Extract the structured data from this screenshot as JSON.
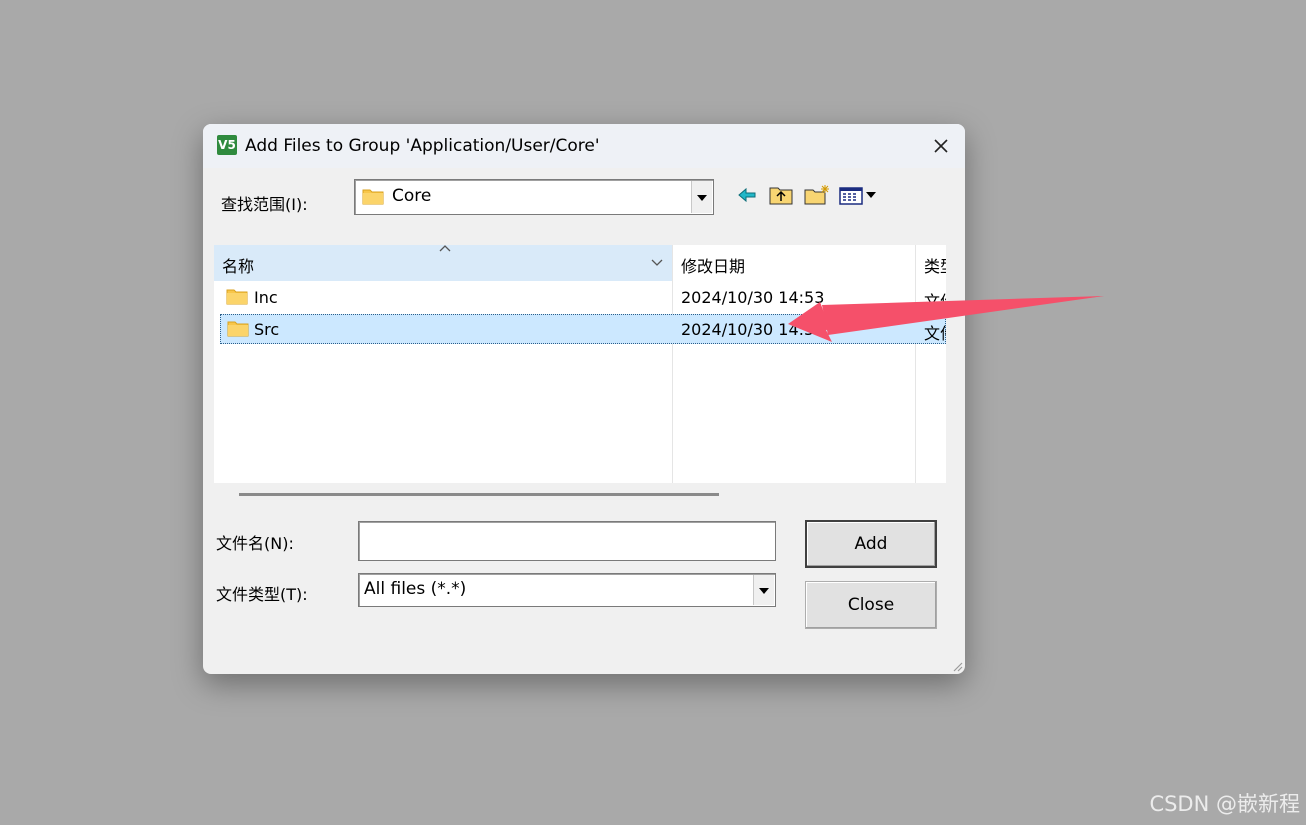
{
  "dialog": {
    "title": "Add Files to Group 'Application/User/Core'",
    "app_icon_label": "V5"
  },
  "lookin": {
    "label": "查找范围(I):",
    "value": "Core"
  },
  "toolbar": {
    "icons": [
      "back-arrow-icon",
      "up-folder-icon",
      "new-folder-icon",
      "view-menu-icon"
    ]
  },
  "file_list": {
    "columns": [
      "名称",
      "修改日期",
      "类型"
    ],
    "rows": [
      {
        "name": "Inc",
        "modified": "2024/10/30 14:53",
        "type": "文件夹"
      },
      {
        "name": "Src",
        "modified": "2024/10/30 14:53",
        "type": "文件夹",
        "selected": true
      }
    ]
  },
  "filename": {
    "label": "文件名(N):",
    "value": ""
  },
  "filetype": {
    "label": "文件类型(T):",
    "value": "All files (*.*)"
  },
  "buttons": {
    "add": "Add",
    "close": "Close"
  },
  "colors": {
    "accent_arrow": "#f5506a",
    "selection": "#cce8ff",
    "header_selected": "#d9eaf9"
  },
  "watermark": "CSDN @嵌新程"
}
